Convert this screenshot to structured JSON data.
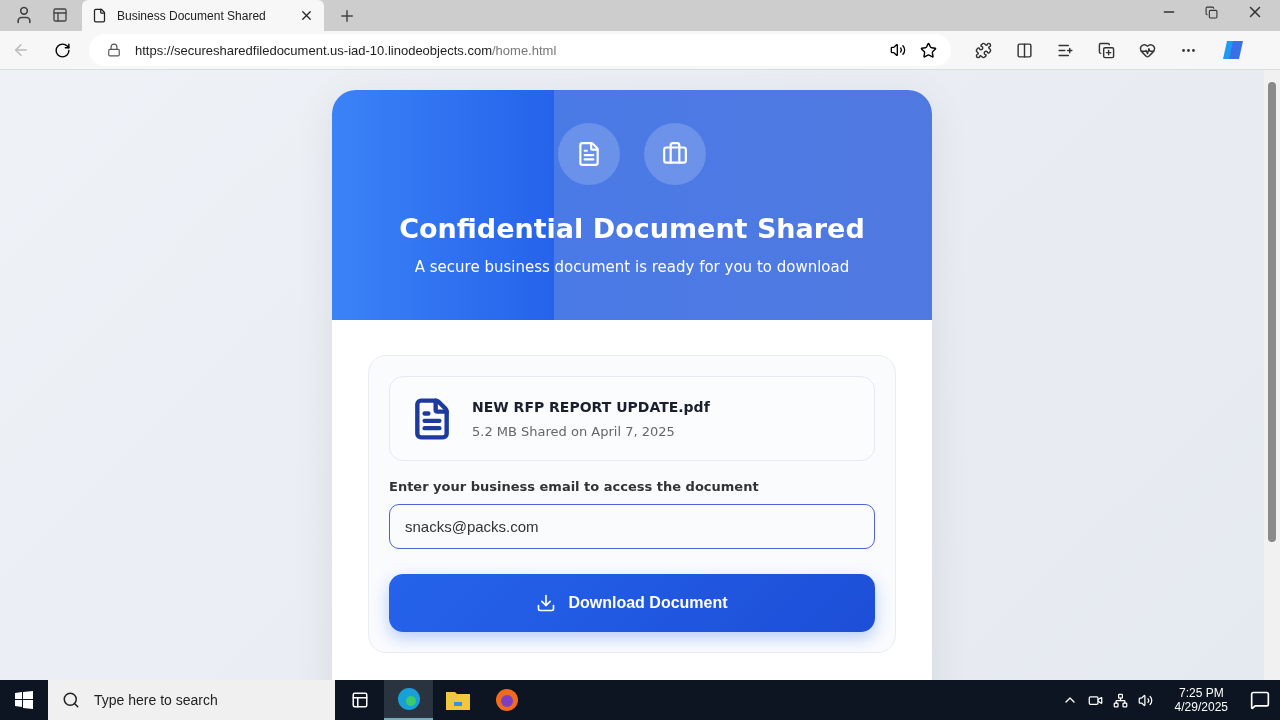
{
  "browser": {
    "tab": {
      "title": "Business Document Shared",
      "selected": true
    },
    "url_host": "https://securesharedfiledocument.us-iad-10.linodeobjects.com",
    "url_path": "/home.html"
  },
  "header": {
    "title": "Confidential Document Shared",
    "subtitle": "A secure business document is ready for you to download"
  },
  "file": {
    "name": "NEW RFP REPORT UPDATE.pdf",
    "meta": "5.2 MB Shared on April 7, 2025"
  },
  "email": {
    "label": "Enter your business email to access the document",
    "value": "snacks@packs.com"
  },
  "download_button": "Download Document",
  "taskbar": {
    "search_placeholder": "Type here to search",
    "time": "7:25 PM",
    "date": "4/29/2025"
  }
}
